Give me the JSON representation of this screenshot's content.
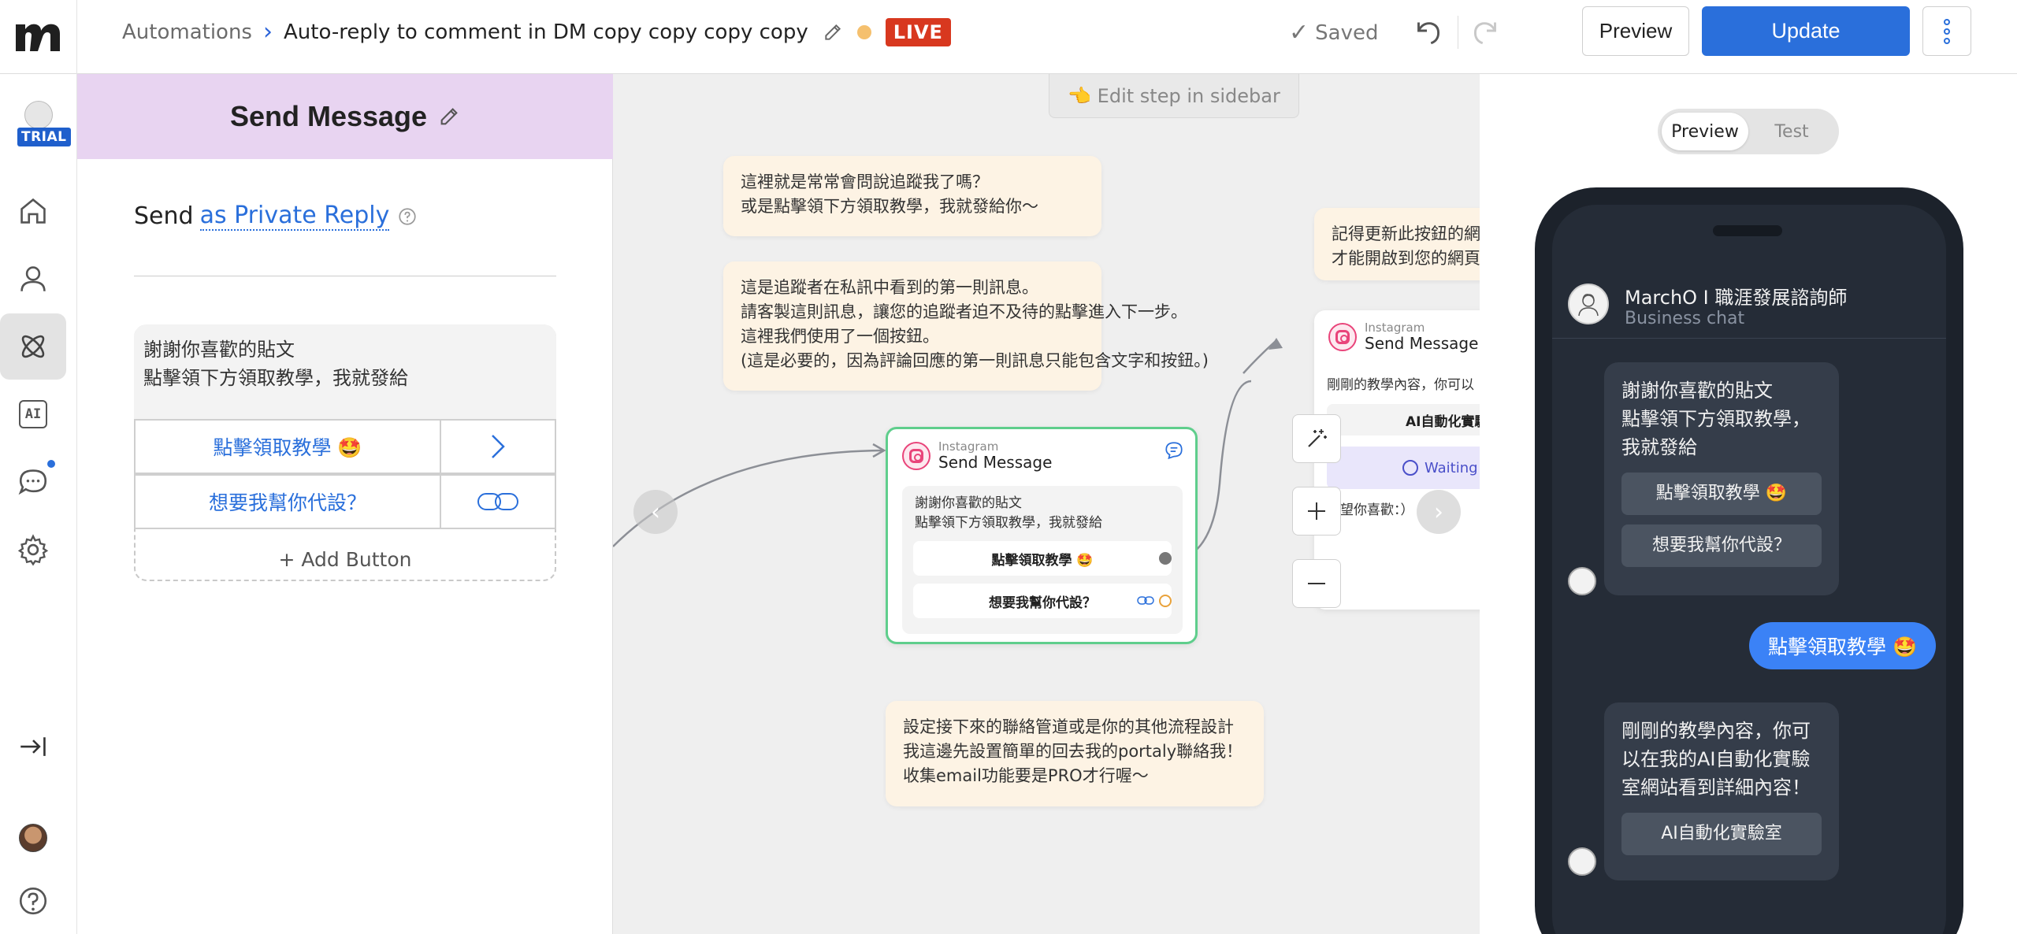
{
  "topbar": {
    "breadcrumb_root": "Automations",
    "breadcrumb_sep": "›",
    "flow_title": "Auto-reply to comment in DM copy copy copy copy",
    "live_badge": "LIVE",
    "saved_check": "✓",
    "saved_label": "Saved",
    "preview_button": "Preview",
    "update_button": "Update"
  },
  "leftnav": {
    "trial_badge": "TRIAL",
    "items": [
      "home-icon",
      "contacts-icon",
      "automation-icon",
      "ai-icon",
      "live-chat-icon",
      "settings-icon"
    ],
    "ai_label": "AI",
    "collapse": "collapse-sidebar-icon",
    "help": "help-icon"
  },
  "editor": {
    "title": "Send Message",
    "send_prefix": "Send",
    "send_mode": "as Private Reply",
    "message_line1": "謝謝你喜歡的貼文",
    "message_line2": "點擊領下方領取教學，我就發給",
    "buttons": [
      {
        "label": "點擊領取教學 🤩"
      },
      {
        "label": "想要我幫你代設？"
      }
    ],
    "add_button": "+ Add Button"
  },
  "canvas": {
    "edit_hint": "👈 Edit step in sidebar",
    "note1": [
      "這裡就是常常會問說追蹤我了嗎？",
      "或是點擊領下方領取教學，我就發給你～"
    ],
    "note2": [
      "這是追蹤者在私訊中看到的第一則訊息。",
      "請客製這則訊息，讓您的追蹤者迫不及待的點擊進入下一步。",
      "這裡我們使用了一個按鈕。",
      "(這是必要的，因為評論回應的第一則訊息只能包含文字和按鈕。)"
    ],
    "note3": [
      "記得更新此按鈕的網",
      "才能開啟到您的網頁"
    ],
    "note4": [
      "設定接下來的聯絡管道或是你的其他流程設計",
      "我這邊先設置簡單的回去我的portaly聯絡我！",
      "收集email功能要是PRO才行喔～"
    ],
    "main_node": {
      "platform": "Instagram",
      "name": "Send Message",
      "text_line1": "謝謝你喜歡的貼文",
      "text_line2": "點擊領下方領取教學，我就發給",
      "button1": "點擊領取教學 🤩",
      "button2": "想要我幫你代設？"
    },
    "right_node": {
      "platform": "Instagram",
      "name": "Send Message",
      "text": "剛剛的教學內容，你可以",
      "button": "AI自動化實驗",
      "waiting": "Waiting",
      "footer": "希望你喜歡：）"
    },
    "tools": [
      "magic-wand-icon",
      "zoom-in-icon",
      "zoom-out-icon"
    ]
  },
  "preview": {
    "tabs": [
      "Preview",
      "Test"
    ],
    "active_tab": "Preview",
    "chat_name": "MarchO I 職涯發展諮詢師",
    "chat_sub": "Business chat",
    "bubble1": [
      "謝謝你喜歡的貼文",
      "點擊領下方領取教學，",
      "我就發給"
    ],
    "bubble1_buttons": [
      "點擊領取教學 🤩",
      "想要我幫你代設？"
    ],
    "outgoing": "點擊領取教學 🤩",
    "bubble2": [
      "剛剛的教學內容，你可",
      "以在我的AI自動化實驗",
      "室網站看到詳細內容！"
    ],
    "bubble2_button": "AI自動化實驗室"
  },
  "colors": {
    "accent_blue": "#2a6fdb",
    "live_red": "#d8381f",
    "editor_header": "#e8d4f1",
    "node_selected": "#5fce8c",
    "note_bg": "#fdf3e4"
  }
}
